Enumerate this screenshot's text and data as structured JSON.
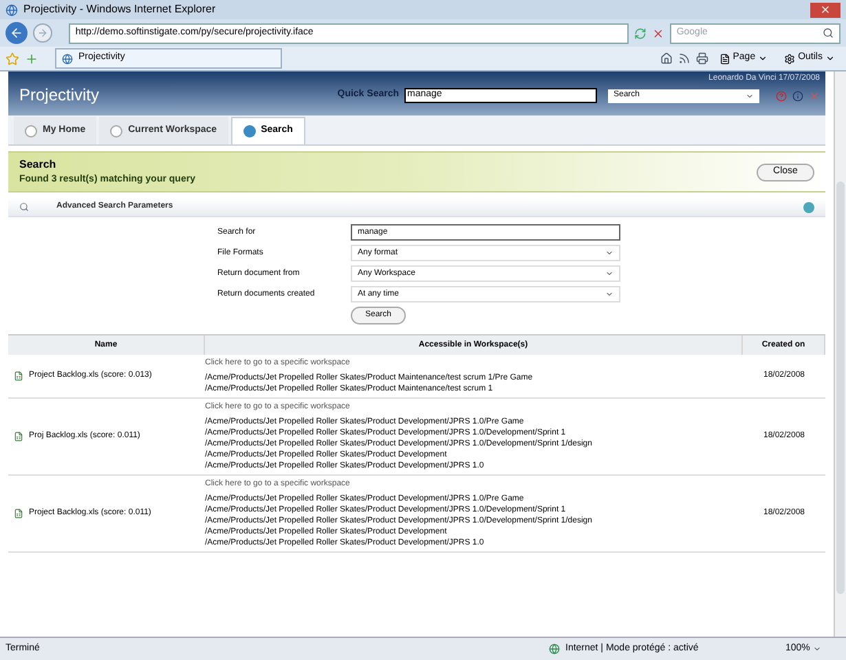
{
  "window": {
    "title": "Projectivity - Windows Internet Explorer"
  },
  "address_bar": {
    "url": "http://demo.softinstigate.com/py/secure/projectivity.iface"
  },
  "browser_search": {
    "placeholder": "Google"
  },
  "browser_tab": {
    "label": "Projectivity"
  },
  "command_bar": [
    "Page",
    "Outils"
  ],
  "app": {
    "logo": "Projectivity",
    "user_info": "Leonardo Da Vinci 17/07/2008",
    "quick_search": {
      "label": "Quick Search",
      "value": "manage",
      "scope": "Search"
    }
  },
  "tabs": [
    {
      "label": "My Home",
      "selected": false
    },
    {
      "label": "Current Workspace",
      "selected": false
    },
    {
      "label": "Search",
      "selected": true
    }
  ],
  "banner": {
    "title": "Search",
    "message": "Found 3 result(s) matching your query",
    "close": "Close"
  },
  "advanced": {
    "title": "Advanced Search Parameters",
    "fields": [
      {
        "kind": "text",
        "label": "Search for",
        "value": "manage"
      },
      {
        "kind": "select",
        "label": "File Formats",
        "value": "Any format"
      },
      {
        "kind": "select",
        "label": "Return document from",
        "value": "Any Workspace"
      },
      {
        "kind": "select",
        "label": "Return documents created",
        "value": "At any time"
      }
    ],
    "button": "Search"
  },
  "table": {
    "columns": [
      "Name",
      "Accessible in Workspace(s)",
      "Created on"
    ],
    "rows": [
      {
        "name": "Project Backlog.xls (score: 0.013)",
        "hint": "Click here to go to a specific workspace",
        "paths": [
          "/Acme/Products/Jet Propelled Roller Skates/Product Maintenance/test scrum 1/Pre Game",
          "/Acme/Products/Jet Propelled Roller Skates/Product Maintenance/test scrum 1"
        ],
        "created": "18/02/2008"
      },
      {
        "name": "Proj Backlog.xls (score: 0.011)",
        "hint": "Click here to go to a specific workspace",
        "paths": [
          "/Acme/Products/Jet Propelled Roller Skates/Product Development/JPRS 1.0/Pre Game",
          "/Acme/Products/Jet Propelled Roller Skates/Product Development/JPRS 1.0/Development/Sprint 1",
          "/Acme/Products/Jet Propelled Roller Skates/Product Development/JPRS 1.0/Development/Sprint 1/design",
          "/Acme/Products/Jet Propelled Roller Skates/Product Development",
          "/Acme/Products/Jet Propelled Roller Skates/Product Development/JPRS 1.0"
        ],
        "created": "18/02/2008"
      },
      {
        "name": "Project Backlog.xls (score: 0.011)",
        "hint": "Click here to go to a specific workspace",
        "paths": [
          "/Acme/Products/Jet Propelled Roller Skates/Product Development/JPRS 1.0/Pre Game",
          "/Acme/Products/Jet Propelled Roller Skates/Product Development/JPRS 1.0/Development/Sprint 1",
          "/Acme/Products/Jet Propelled Roller Skates/Product Development/JPRS 1.0/Development/Sprint 1/design",
          "/Acme/Products/Jet Propelled Roller Skates/Product Development",
          "/Acme/Products/Jet Propelled Roller Skates/Product Development/JPRS 1.0"
        ],
        "created": "18/02/2008"
      }
    ]
  },
  "status_bar": {
    "status": "Terminé",
    "zone": "Internet | Mode protégé : activé",
    "zoom": "100%"
  }
}
